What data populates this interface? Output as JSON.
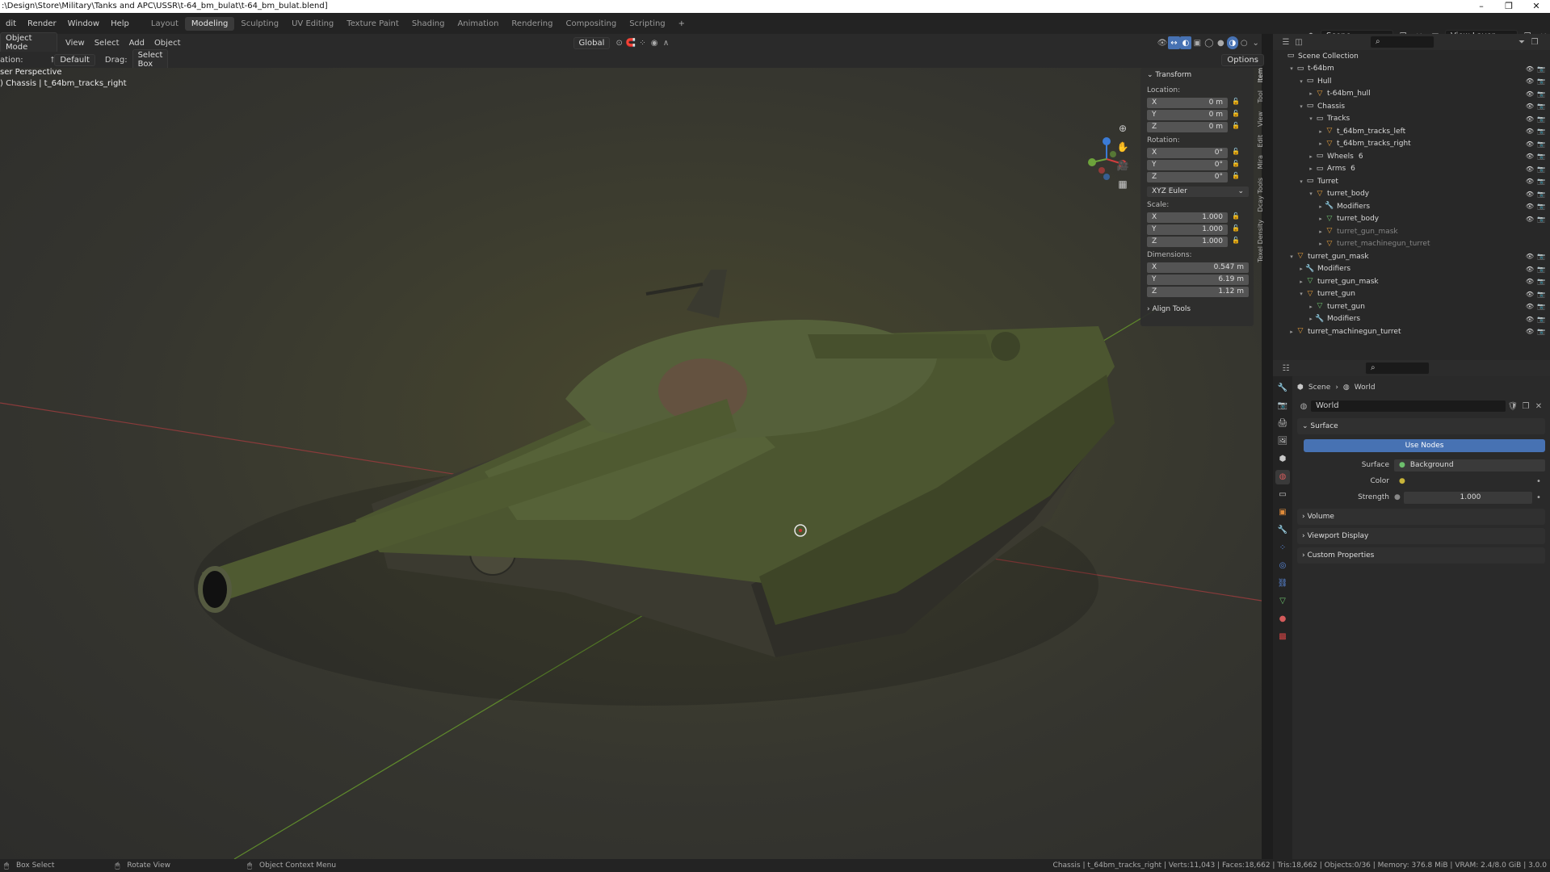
{
  "window": {
    "title": ":\\Design\\Store\\Military\\Tanks and APC\\USSR\\t-64_bm_bulat\\t-64_bm_bulat.blend]",
    "minimize": "–",
    "maximize": "❐",
    "close": "✕"
  },
  "menu": [
    "dit",
    "Render",
    "Window",
    "Help"
  ],
  "workspaces": [
    "Layout",
    "Modeling",
    "Sculpting",
    "UV Editing",
    "Texture Paint",
    "Shading",
    "Animation",
    "Rendering",
    "Compositing",
    "Scripting",
    "+"
  ],
  "active_workspace": "Modeling",
  "scene": {
    "name": "Scene",
    "view_layer": "View Layer"
  },
  "viewport_header": {
    "mode": "Object Mode",
    "menus": [
      "View",
      "Select",
      "Add",
      "Object"
    ],
    "transform": "Global",
    "options": "Options"
  },
  "tool_settings": {
    "orientation_label": "ation:",
    "orientation": "Default",
    "drag_label": "Drag:",
    "drag": "Select Box"
  },
  "viewport": {
    "perspective": "ser Perspective",
    "object_info": ") Chassis | t_64bm_tracks_right"
  },
  "npanel": {
    "transform_title": "Transform",
    "location_label": "Location:",
    "location": [
      {
        "axis": "X",
        "value": "0 m"
      },
      {
        "axis": "Y",
        "value": "0 m"
      },
      {
        "axis": "Z",
        "value": "0 m"
      }
    ],
    "rotation_label": "Rotation:",
    "rotation": [
      {
        "axis": "X",
        "value": "0°"
      },
      {
        "axis": "Y",
        "value": "0°"
      },
      {
        "axis": "Z",
        "value": "0°"
      }
    ],
    "rotation_mode": "XYZ Euler",
    "scale_label": "Scale:",
    "scale": [
      {
        "axis": "X",
        "value": "1.000"
      },
      {
        "axis": "Y",
        "value": "1.000"
      },
      {
        "axis": "Z",
        "value": "1.000"
      }
    ],
    "dimensions_label": "Dimensions:",
    "dimensions": [
      {
        "axis": "X",
        "value": "0.547 m"
      },
      {
        "axis": "Y",
        "value": "6.19 m"
      },
      {
        "axis": "Z",
        "value": "1.12 m"
      }
    ],
    "align_tools": "Align Tools",
    "tabs": [
      "Item",
      "Tool",
      "View",
      "Edit",
      "Mira",
      "Dcay Tools",
      "Texel Density"
    ]
  },
  "outliner": {
    "rows": [
      {
        "depth": 0,
        "icon": "collection-icon",
        "label": "Scene Collection",
        "twisty": ""
      },
      {
        "depth": 1,
        "icon": "collection-icon",
        "label": "t-64bm",
        "twisty": "▾"
      },
      {
        "depth": 2,
        "icon": "collection-icon",
        "label": "Hull",
        "twisty": "▾"
      },
      {
        "depth": 3,
        "icon": "object-icon",
        "label": "t-64bm_hull",
        "twisty": "▸"
      },
      {
        "depth": 2,
        "icon": "collection-icon",
        "label": "Chassis",
        "twisty": "▾"
      },
      {
        "depth": 3,
        "icon": "collection-icon",
        "label": "Tracks",
        "twisty": "▾"
      },
      {
        "depth": 4,
        "icon": "object-icon",
        "label": "t_64bm_tracks_left",
        "twisty": "▸"
      },
      {
        "depth": 4,
        "icon": "object-icon",
        "label": "t_64bm_tracks_right",
        "twisty": "▸"
      },
      {
        "depth": 3,
        "icon": "collection-icon",
        "label": "Wheels",
        "twisty": "▸",
        "sub": "6"
      },
      {
        "depth": 3,
        "icon": "collection-icon",
        "label": "Arms",
        "twisty": "▸",
        "sub": "6"
      },
      {
        "depth": 2,
        "icon": "collection-icon",
        "label": "Turret",
        "twisty": "▾"
      },
      {
        "depth": 3,
        "icon": "object-icon",
        "label": "turret_body",
        "twisty": "▾"
      },
      {
        "depth": 4,
        "icon": "wrench-icon",
        "label": "Modifiers",
        "twisty": "▸"
      },
      {
        "depth": 4,
        "icon": "mesh-icon",
        "label": "turret_body",
        "twisty": "▸"
      },
      {
        "depth": 4,
        "icon": "object-icon",
        "label": "turret_gun_mask",
        "twisty": "▸",
        "dim": true
      },
      {
        "depth": 4,
        "icon": "object-icon",
        "label": "turret_machinegun_turret",
        "twisty": "▸",
        "dim": true
      },
      {
        "depth": 1,
        "icon": "object-icon",
        "label": "turret_gun_mask",
        "twisty": "▾"
      },
      {
        "depth": 2,
        "icon": "wrench-icon",
        "label": "Modifiers",
        "twisty": "▸"
      },
      {
        "depth": 2,
        "icon": "mesh-icon",
        "label": "turret_gun_mask",
        "twisty": "▸"
      },
      {
        "depth": 2,
        "icon": "object-icon",
        "label": "turret_gun",
        "twisty": "▾"
      },
      {
        "depth": 3,
        "icon": "mesh-icon",
        "label": "turret_gun",
        "twisty": "▸"
      },
      {
        "depth": 3,
        "icon": "wrench-icon",
        "label": "Modifiers",
        "twisty": "▸"
      },
      {
        "depth": 1,
        "icon": "object-icon",
        "label": "turret_machinegun_turret",
        "twisty": "▸"
      }
    ]
  },
  "properties": {
    "breadcrumb": [
      "Scene",
      "World"
    ],
    "world_name": "World",
    "surface_section": "Surface",
    "use_nodes": "Use Nodes",
    "surface_label": "Surface",
    "surface_value": "Background",
    "color_label": "Color",
    "strength_label": "Strength",
    "strength_value": "1.000",
    "collapsed_sections": [
      "Volume",
      "Viewport Display",
      "Custom Properties"
    ]
  },
  "status": {
    "left_1": "Box Select",
    "left_2": "Rotate View",
    "left_3": "Object Context Menu",
    "right": "Chassis | t_64bm_tracks_right | Verts:11,043 | Faces:18,662 | Tris:18,662 | Objects:0/36 | Memory: 376.8 MiB | VRAM: 2.4/8.0 GiB | 3.0.0"
  },
  "colors": {
    "accent": "#4772b3",
    "tank": "#4c5630",
    "axis_x": "#a63a3a",
    "axis_y": "#6a9a2a"
  }
}
